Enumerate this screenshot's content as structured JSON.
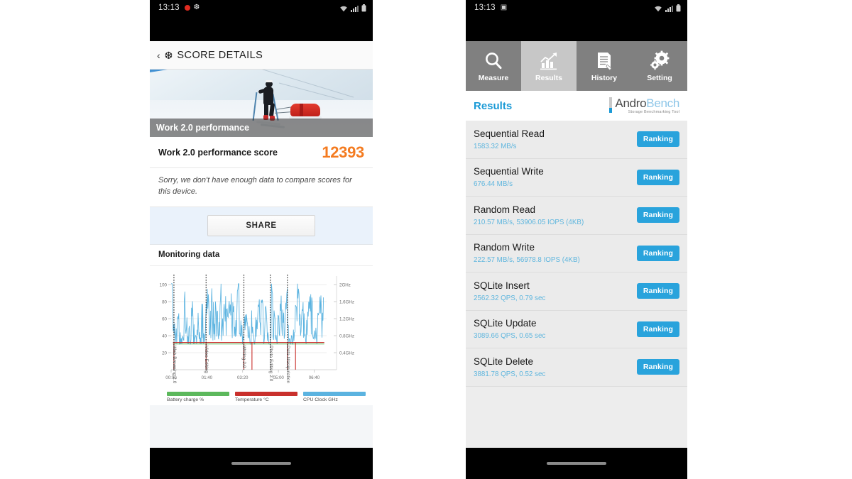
{
  "left_phone": {
    "statusbar": {
      "time": "13:13",
      "left_icons": [
        "record-dot-icon",
        "snowflake-icon"
      ],
      "right_icons": [
        "wifi-icon",
        "signal-icon",
        "battery-icon"
      ]
    },
    "appbar": {
      "back_label": "‹",
      "logo_icon": "snowflake-icon",
      "title": "SCORE DETAILS"
    },
    "hero": {
      "caption": "Work 2.0 performance",
      "image_alt": "skier-pulling-sled-snow-photo"
    },
    "score": {
      "label": "Work 2.0 performance score",
      "value": "12393",
      "value_color": "#f47b20"
    },
    "note": "Sorry, we don't have enough data to compare scores for this device.",
    "share_button": "SHARE",
    "monitoring": {
      "title": "Monitoring data"
    },
    "chart_data": {
      "type": "line",
      "title": "Monitoring data",
      "xlabel": "",
      "ylabel": "",
      "grid": true,
      "legend_position": "bottom",
      "x_ticks": [
        "00:00",
        "01:40",
        "03:20",
        "05:00",
        "06:40"
      ],
      "y_left_ticks": [
        "20",
        "40",
        "60",
        "80",
        "100"
      ],
      "y_left_range": [
        0,
        110
      ],
      "y_right_ticks": [
        "0.4GHz",
        "0.8GHz",
        "1.2GHz",
        "1.6GHz",
        "2GHz"
      ],
      "y_right_range": [
        0,
        2.2
      ],
      "workload_markers": [
        {
          "label": "Web Browsing 2.0",
          "x_time": "00:07"
        },
        {
          "label": "Video Editing",
          "x_time": "01:12"
        },
        {
          "label": "Writing 2.0",
          "x_time": "02:52"
        },
        {
          "label": "Photo Editing 2.0",
          "x_time": "04:05"
        },
        {
          "label": "Data Manipulation",
          "x_time": "04:48"
        }
      ],
      "series": [
        {
          "name": "Battery charge %",
          "color": "#5cb85c",
          "values": [
            31,
            31,
            31,
            31,
            31,
            31,
            31,
            31,
            30,
            30,
            30,
            30,
            30,
            30,
            30,
            30,
            30,
            30,
            30,
            30,
            30,
            30,
            30,
            30,
            30,
            30,
            30,
            30,
            30,
            30,
            30,
            30,
            30,
            30,
            30,
            30,
            30,
            30,
            30,
            30,
            30,
            30,
            30,
            30,
            30,
            30,
            30,
            30,
            30,
            30
          ]
        },
        {
          "name": "Temperature °C",
          "color": "#c9302c",
          "values": [
            32,
            32,
            32,
            32,
            32,
            32,
            32,
            32,
            32,
            32,
            32,
            32,
            32,
            32,
            32,
            32,
            32,
            32,
            32,
            32,
            32,
            32,
            32,
            32,
            32,
            32,
            32,
            32,
            32,
            32,
            32,
            32,
            32,
            32,
            32,
            32,
            32,
            32,
            32,
            32,
            32,
            32,
            32,
            32,
            32,
            32,
            32,
            32,
            32,
            32
          ]
        },
        {
          "name": "CPU Clock GHz",
          "color": "#5bb3e0",
          "values": [
            100,
            44,
            38,
            58,
            34,
            36,
            82,
            50,
            34,
            34,
            70,
            36,
            34,
            58,
            36,
            70,
            34,
            72,
            80,
            78,
            78,
            64,
            80,
            66,
            88,
            48,
            70,
            74,
            64,
            78,
            62,
            60,
            62,
            100,
            42,
            36,
            54,
            52,
            36,
            36,
            52,
            36,
            54,
            78,
            64,
            64,
            34,
            58,
            40,
            36,
            100,
            60,
            36,
            62,
            72,
            52,
            58,
            78,
            38,
            36,
            34,
            46,
            60,
            86,
            48,
            62,
            50,
            44,
            70,
            76,
            76,
            44,
            44,
            70,
            70,
            72
          ]
        }
      ],
      "legend": [
        {
          "label": "Battery charge %",
          "color": "#5cb85c"
        },
        {
          "label": "Temperature °C",
          "color": "#c9302c"
        },
        {
          "label": "CPU Clock GHz",
          "color": "#5bb3e0"
        }
      ]
    }
  },
  "right_phone": {
    "statusbar": {
      "time": "13:13",
      "left_icons": [
        "photo-icon"
      ],
      "right_icons": [
        "wifi-icon",
        "signal-icon",
        "battery-icon"
      ]
    },
    "tabs": [
      {
        "label": "Measure",
        "icon": "magnifier-icon",
        "active": false
      },
      {
        "label": "Results",
        "icon": "bar-chart-icon",
        "active": true
      },
      {
        "label": "History",
        "icon": "document-pen-icon",
        "active": false
      },
      {
        "label": "Setting",
        "icon": "gears-icon",
        "active": false
      }
    ],
    "header": {
      "title": "Results",
      "brand_part1": "Andro",
      "brand_part2": "Bench",
      "brand_tagline": "Storage Benchmarking Tool"
    },
    "results": [
      {
        "name": "Sequential Read",
        "value": "1583.32 MB/s",
        "action": "Ranking"
      },
      {
        "name": "Sequential Write",
        "value": "676.44 MB/s",
        "action": "Ranking"
      },
      {
        "name": "Random Read",
        "value": "210.57 MB/s, 53906.05 IOPS (4KB)",
        "action": "Ranking"
      },
      {
        "name": "Random Write",
        "value": "222.57 MB/s, 56978.8 IOPS (4KB)",
        "action": "Ranking"
      },
      {
        "name": "SQLite Insert",
        "value": "2562.32 QPS, 0.79 sec",
        "action": "Ranking"
      },
      {
        "name": "SQLite Update",
        "value": "3089.66 QPS, 0.65 sec",
        "action": "Ranking"
      },
      {
        "name": "SQLite Delete",
        "value": "3881.78 QPS, 0.52 sec",
        "action": "Ranking"
      }
    ]
  },
  "colors": {
    "accent_orange": "#f47b20",
    "accent_blue": "#29a3dc",
    "tab_active_bg": "#c7c7c7",
    "tab_bg": "#808080"
  }
}
